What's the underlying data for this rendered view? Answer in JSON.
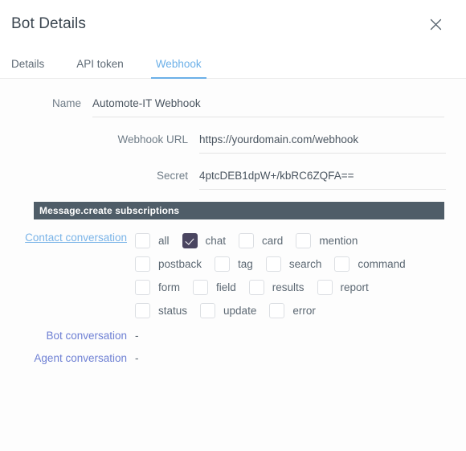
{
  "dialog": {
    "title": "Bot Details",
    "close_icon": "close-icon"
  },
  "tabs": [
    {
      "label": "Details",
      "active": false
    },
    {
      "label": "API token",
      "active": false
    },
    {
      "label": "Webhook",
      "active": true
    }
  ],
  "form": {
    "name": {
      "label": "Name",
      "value": "Automote-IT Webhook"
    },
    "webhook_url": {
      "label": "Webhook URL",
      "value": "https://yourdomain.com/webhook"
    },
    "secret": {
      "label": "Secret",
      "value": "4ptcDEB1dpW+/kbRC6ZQFA=="
    }
  },
  "subscriptions": {
    "section_title": "Message.create subscriptions",
    "rows": [
      {
        "label": "Contact conversation",
        "label_style": "link",
        "lines": [
          [
            {
              "name": "all",
              "checked": false
            },
            {
              "name": "chat",
              "checked": true
            },
            {
              "name": "card",
              "checked": false
            },
            {
              "name": "mention",
              "checked": false
            }
          ],
          [
            {
              "name": "postback",
              "checked": false
            },
            {
              "name": "tag",
              "checked": false
            },
            {
              "name": "search",
              "checked": false
            },
            {
              "name": "command",
              "checked": false
            }
          ],
          [
            {
              "name": "form",
              "checked": false
            },
            {
              "name": "field",
              "checked": false
            },
            {
              "name": "results",
              "checked": false
            },
            {
              "name": "report",
              "checked": false
            }
          ],
          [
            {
              "name": "status",
              "checked": false
            },
            {
              "name": "update",
              "checked": false
            },
            {
              "name": "error",
              "checked": false
            }
          ]
        ]
      },
      {
        "label": "Bot conversation",
        "label_style": "plain",
        "value": "-"
      },
      {
        "label": "Agent conversation",
        "label_style": "plain",
        "value": "-"
      }
    ]
  },
  "colors": {
    "accent_tab": "#6cb0e8",
    "link": "#7ab4e8",
    "label_blue": "#6e80d4",
    "section_bar": "#4f5d68",
    "checkbox_checked": "#4a4560"
  }
}
